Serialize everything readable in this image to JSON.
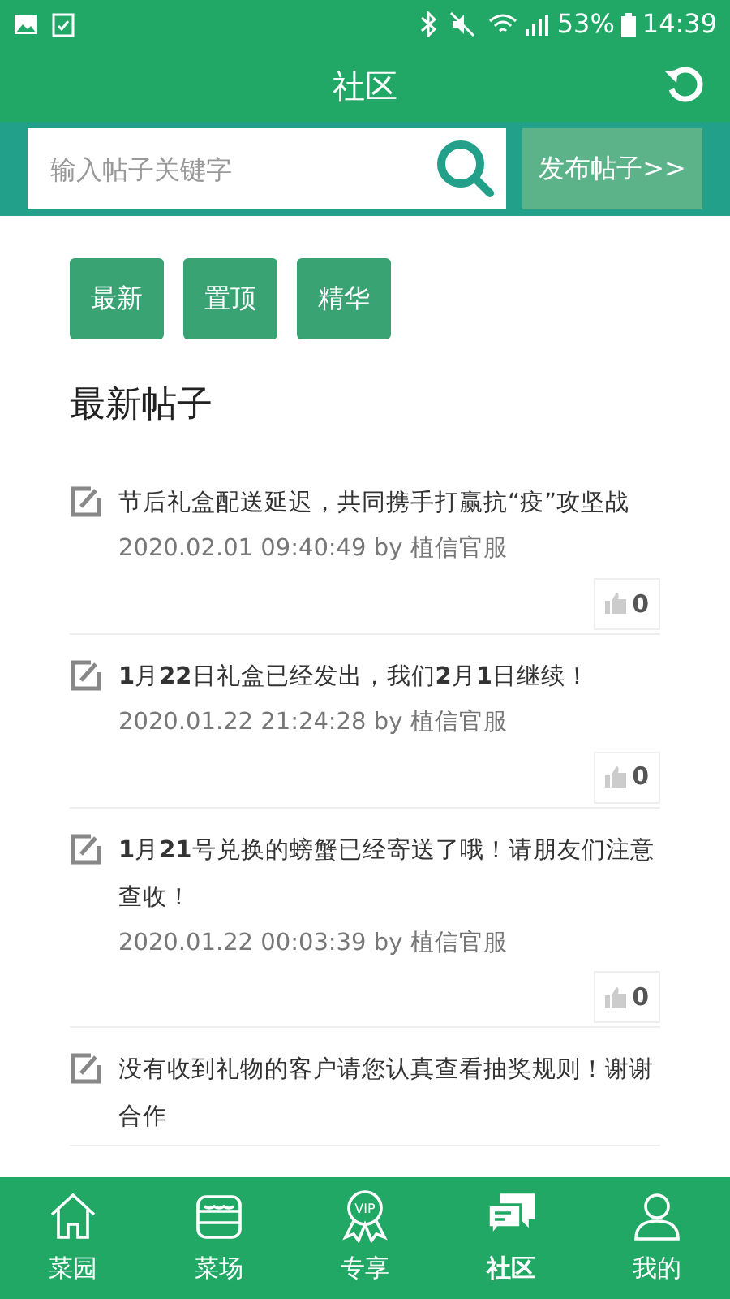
{
  "status_bar": {
    "battery": "53%",
    "time": "14:39"
  },
  "header": {
    "title": "社区"
  },
  "search": {
    "placeholder": "输入帖子关键字",
    "publish_button": "发布帖子>>"
  },
  "filters": [
    {
      "label": "最新"
    },
    {
      "label": "置顶"
    },
    {
      "label": "精华"
    }
  ],
  "section_title": "最新帖子",
  "posts": [
    {
      "title": "节后礼盒配送延迟，共同携手打赢抗“疫”攻坚战",
      "meta": "2020.02.01 09:40:49 by 植信官服",
      "likes": "0"
    },
    {
      "title": "**1**月**22**日礼盒已经发出，我们**2**月**1**日继续！",
      "meta": "2020.01.22 21:24:28 by 植信官服",
      "likes": "0"
    },
    {
      "title": "**1**月**21**号兑换的螃蟹已经寄送了哦！请朋友们注意查收！",
      "meta": "2020.01.22 00:03:39 by 植信官服",
      "likes": "0"
    },
    {
      "title": "没有收到礼物的客户请您认真查看抽奖规则！谢谢合作"
    }
  ],
  "nav": [
    {
      "kind": "home",
      "label": "菜园",
      "selected": false
    },
    {
      "kind": "store",
      "label": "菜场",
      "selected": false
    },
    {
      "kind": "medal",
      "label": "专享",
      "icon_text": "VIP",
      "selected": false
    },
    {
      "kind": "chat",
      "label": "社区",
      "selected": true
    },
    {
      "kind": "person",
      "label": "我的",
      "selected": false
    }
  ]
}
